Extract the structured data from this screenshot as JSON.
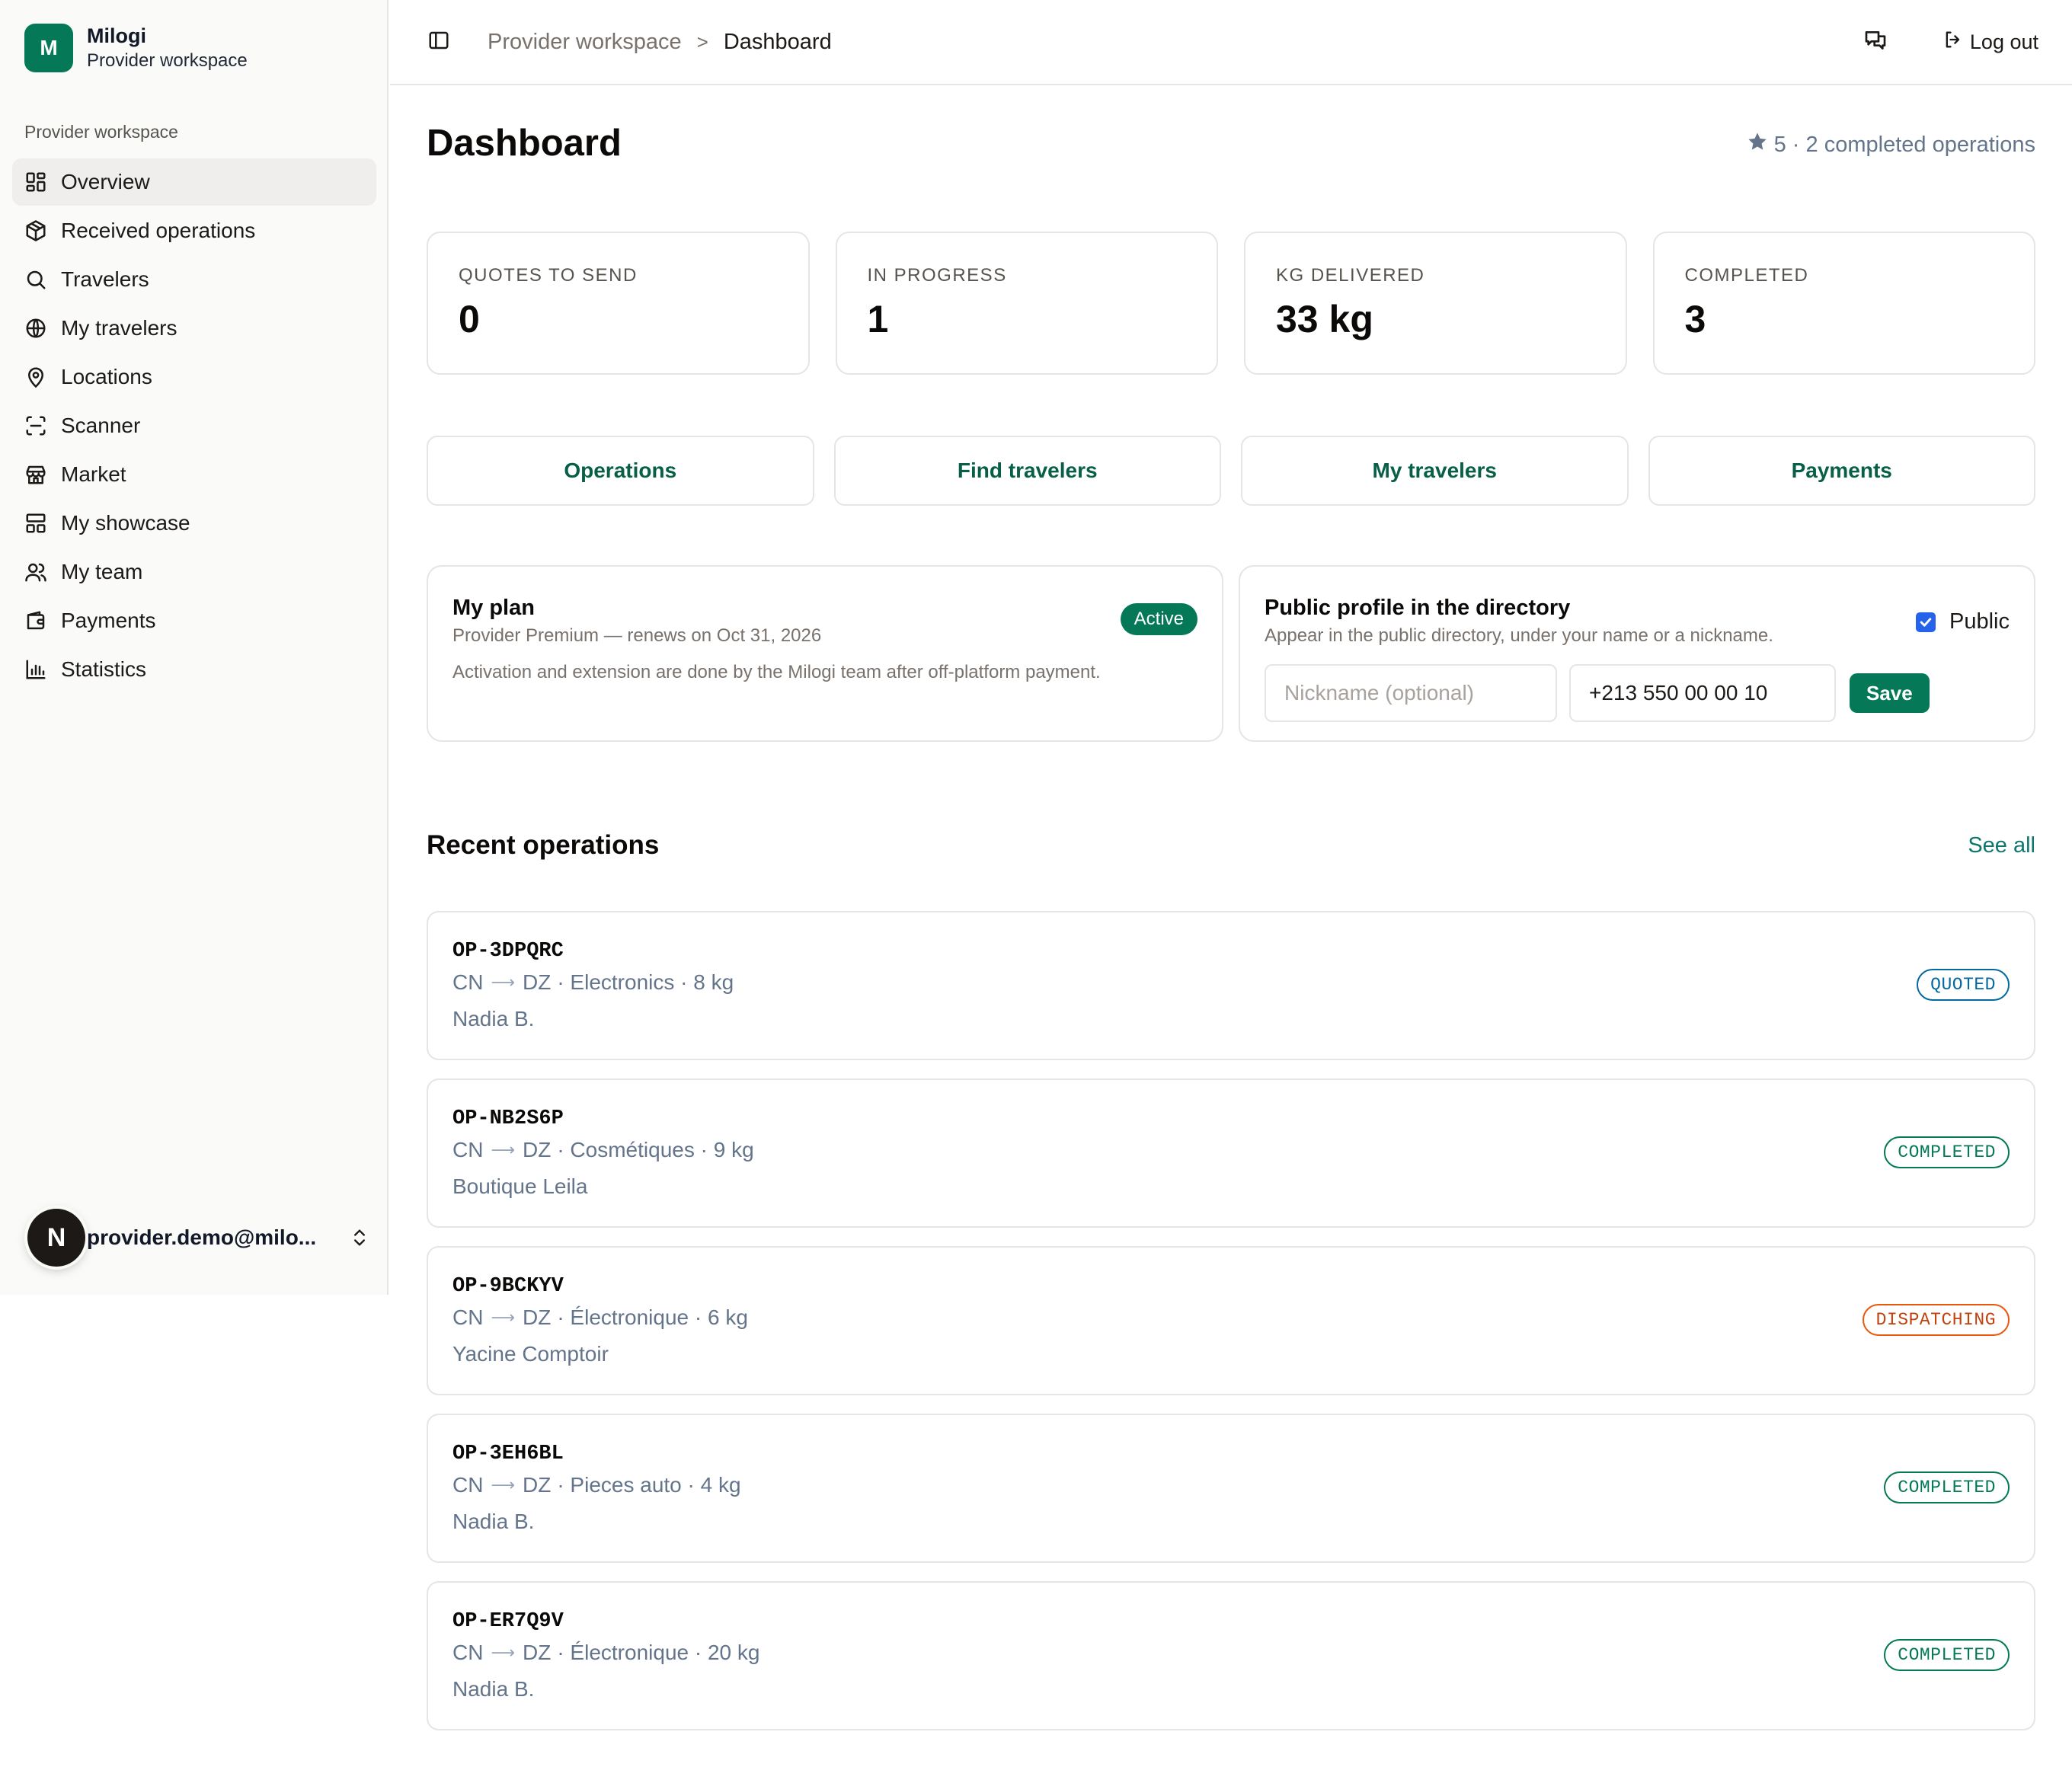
{
  "brand": {
    "logo_letter": "M",
    "name": "Milogi",
    "subtitle": "Provider workspace"
  },
  "sidebar": {
    "section_label": "Provider workspace",
    "items": [
      {
        "label": "Overview",
        "icon": "grid-icon",
        "active": true
      },
      {
        "label": "Received operations",
        "icon": "package-icon"
      },
      {
        "label": "Travelers",
        "icon": "search-icon"
      },
      {
        "label": "My travelers",
        "icon": "globe-icon"
      },
      {
        "label": "Locations",
        "icon": "map-pin-icon"
      },
      {
        "label": "Scanner",
        "icon": "scan-icon"
      },
      {
        "label": "Market",
        "icon": "store-icon"
      },
      {
        "label": "My showcase",
        "icon": "layout-icon"
      },
      {
        "label": "My team",
        "icon": "users-icon"
      },
      {
        "label": "Payments",
        "icon": "wallet-icon"
      },
      {
        "label": "Statistics",
        "icon": "bar-chart-icon"
      }
    ],
    "user": {
      "avatar_letter": "N",
      "email": "provider.demo@milo..."
    }
  },
  "topbar": {
    "breadcrumb_parent": "Provider workspace",
    "breadcrumb_separator": ">",
    "breadcrumb_current": "Dashboard",
    "logout_label": "Log out"
  },
  "main": {
    "title": "Dashboard",
    "rating_text": "5 · 2 completed operations",
    "stats": [
      {
        "label": "QUOTES TO SEND",
        "value": "0"
      },
      {
        "label": "IN PROGRESS",
        "value": "1"
      },
      {
        "label": "KG DELIVERED",
        "value": "33 kg"
      },
      {
        "label": "COMPLETED",
        "value": "3"
      }
    ],
    "quick_links": [
      "Operations",
      "Find travelers",
      "My travelers",
      "Payments"
    ],
    "plan": {
      "title": "My plan",
      "subtitle": "Provider Premium — renews on Oct 31, 2026",
      "note": "Activation and extension are done by the Milogi team after off-platform payment.",
      "badge": "Active"
    },
    "profile": {
      "title": "Public profile in the directory",
      "subtitle": "Appear in the public directory, under your name or a nickname.",
      "public_label": "Public",
      "public_checked": true,
      "nickname_placeholder": "Nickname (optional)",
      "nickname_value": "",
      "phone_value": "+213 550 00 00 10",
      "save_label": "Save"
    },
    "recent": {
      "title": "Recent operations",
      "see_all": "See all",
      "arrow": "⟶",
      "items": [
        {
          "id": "OP-3DPQRC",
          "from": "CN",
          "to": "DZ",
          "details": "· Electronics · 8 kg",
          "client": "Nadia B.",
          "status": "QUOTED"
        },
        {
          "id": "OP-NB2S6P",
          "from": "CN",
          "to": "DZ",
          "details": "· Cosmétiques · 9 kg",
          "client": "Boutique Leila",
          "status": "COMPLETED"
        },
        {
          "id": "OP-9BCKYV",
          "from": "CN",
          "to": "DZ",
          "details": "· Électronique · 6 kg",
          "client": "Yacine Comptoir",
          "status": "DISPATCHING"
        },
        {
          "id": "OP-3EH6BL",
          "from": "CN",
          "to": "DZ",
          "details": "· Pieces auto · 4 kg",
          "client": "Nadia B.",
          "status": "COMPLETED"
        },
        {
          "id": "OP-ER7Q9V",
          "from": "CN",
          "to": "DZ",
          "details": "· Électronique · 20 kg",
          "client": "Nadia B.",
          "status": "COMPLETED"
        }
      ]
    }
  },
  "colors": {
    "accent": "#047857",
    "quoted": "#0369a1",
    "completed": "#047857",
    "dispatching": "#ea580c"
  }
}
